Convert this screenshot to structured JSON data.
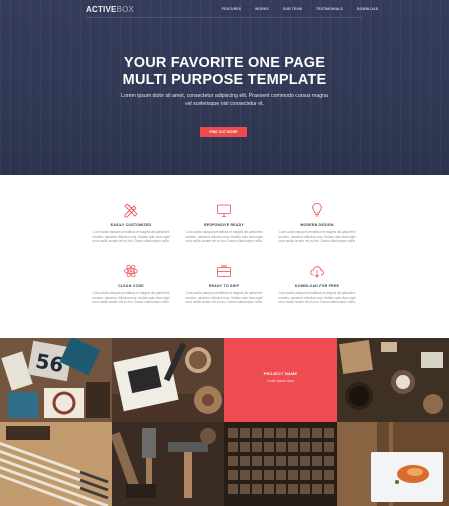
{
  "brand": {
    "part1": "ACTIVE",
    "part2": "BOX"
  },
  "nav": [
    "FEATURES",
    "WORKS",
    "OUR TEAM",
    "TESTIMONIALS",
    "DOWNLOAD"
  ],
  "hero": {
    "title_line1": "YOUR FAVORITE ONE PAGE",
    "title_line2": "MULTI PURPOSE TEMPLATE",
    "subtitle_line1": "Lorem ipsum dolor sit amet, consectetur adipiscing elit. Praesent commodo cursus magna",
    "subtitle_line2": "vel scelerisque nisl consectetur et.",
    "button": "FIND OUT MORE"
  },
  "features": [
    {
      "title": "EASILY CUSTOMIZED",
      "icon": "pencil-ruler-icon",
      "desc": "Cum sociis natoque penatibus et magnis dis parturient montes, nascetur ridiculus mus. Nullam quis risus eget urna mollis ornare vel eu leo. Donec ullamcorper nulla."
    },
    {
      "title": "RESPONSIVE READY",
      "icon": "monitor-icon",
      "desc": "Cum sociis natoque penatibus et magnis dis parturient montes, nascetur ridiculus mus. Nullam quis risus eget urna mollis ornare vel eu leo. Donec ullamcorper nulla."
    },
    {
      "title": "MODERN DESIGN",
      "icon": "lightbulb-icon",
      "desc": "Cum sociis natoque penatibus et magnis dis parturient montes, nascetur ridiculus mus. Nullam quis risus eget urna mollis ornare vel eu leo. Donec ullamcorper nulla."
    },
    {
      "title": "CLEAN CODE",
      "icon": "atom-icon",
      "desc": "Cum sociis natoque penatibus et magnis dis parturient montes, nascetur ridiculus mus. Nullam quis risus eget urna mollis ornare vel eu leo. Donec ullamcorper nulla."
    },
    {
      "title": "READY TO SHIP",
      "icon": "briefcase-icon",
      "desc": "Cum sociis natoque penatibus et magnis dis parturient montes, nascetur ridiculus mus. Nullam quis risus eget urna mollis ornare vel eu leo. Donec ullamcorper nulla."
    },
    {
      "title": "DOWNLOAD FOR FREE",
      "icon": "cloud-download-icon",
      "desc": "Cum sociis natoque penatibus et magnis dis parturient montes, nascetur ridiculus mus. Nullam quis risus eget urna mollis ornare vel eu leo. Donec ullamcorper nulla."
    }
  ],
  "gallery": {
    "overlay_name": "PROJECT NAME",
    "overlay_category": "Lorem ipsum dolor"
  },
  "colors": {
    "accent": "#ef4b4f",
    "hero_bg": "#333a57"
  }
}
